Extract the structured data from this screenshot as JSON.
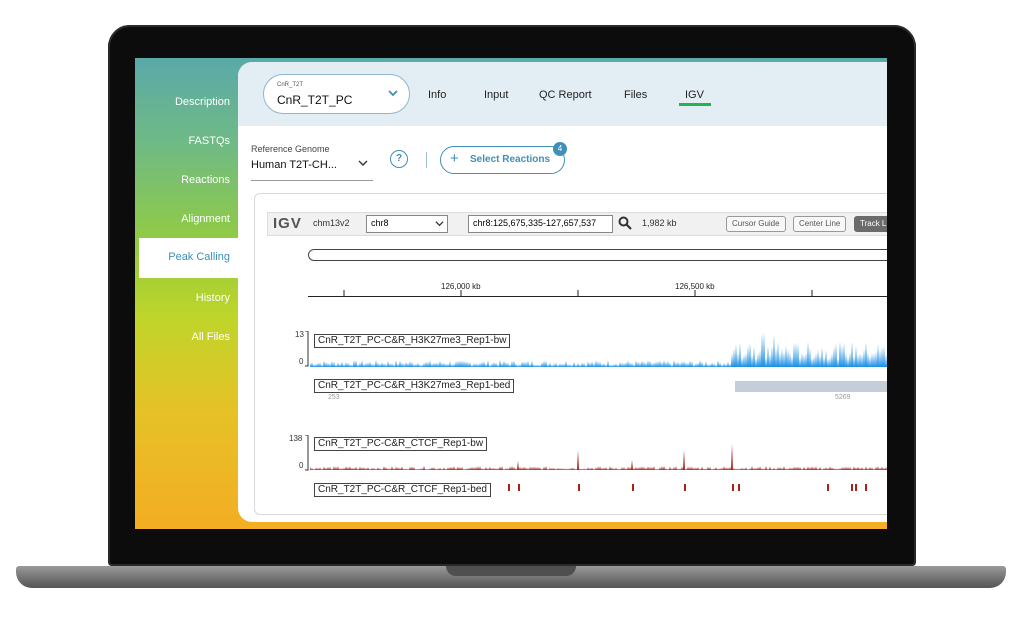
{
  "sidebar": {
    "items": [
      {
        "label": "Description"
      },
      {
        "label": "FASTQs"
      },
      {
        "label": "Reactions"
      },
      {
        "label": "Alignment"
      },
      {
        "label": "Peak Calling"
      },
      {
        "label": "History"
      },
      {
        "label": "All Files"
      }
    ],
    "active": "Peak Calling"
  },
  "project": {
    "small_label": "CnR_T2T",
    "value": "CnR_T2T_PC"
  },
  "tabs": [
    {
      "label": "Info"
    },
    {
      "label": "Input"
    },
    {
      "label": "QC Report"
    },
    {
      "label": "Files"
    },
    {
      "label": "IGV",
      "active": true
    }
  ],
  "reference": {
    "label": "Reference Genome",
    "value": "Human T2T-CH..."
  },
  "select_reactions": {
    "label": "Select Reactions",
    "badge": "4"
  },
  "igv": {
    "logo": "IGV",
    "genome": "chm13v2",
    "chromosome": "chr8",
    "locus": "chr8:125,675,335-127,657,537",
    "span": "1,982 kb",
    "buttons": [
      "Cursor Guide",
      "Center Line",
      "Track L"
    ],
    "ruler_labels": [
      "126,000 kb",
      "126,500 kb"
    ],
    "tracks": [
      {
        "name": "CnR_T2T_PC-C&R_H3K27me3_Rep1-bw",
        "max": "13",
        "min": "0",
        "color": "#1a8fe3"
      },
      {
        "name": "CnR_T2T_PC-C&R_H3K27me3_Rep1-bed",
        "left_num": "253",
        "right_num": "5269",
        "color": "#c5cdd9"
      },
      {
        "name": "CnR_T2T_PC-C&R_CTCF_Rep1-bw",
        "max": "138",
        "min": "0",
        "color": "#a4231d"
      },
      {
        "name": "CnR_T2T_PC-C&R_CTCF_Rep1-bed",
        "color": "#a4231d"
      }
    ]
  },
  "colors": {
    "accent": "#3f8fb8",
    "active_tab": "#24b24c"
  }
}
